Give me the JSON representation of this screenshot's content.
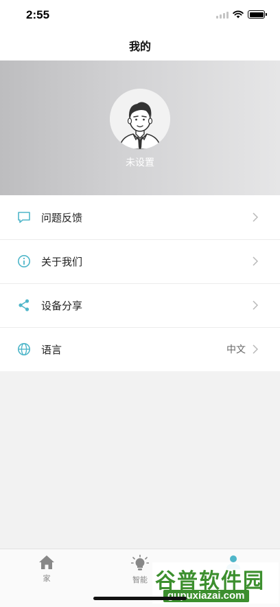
{
  "status_bar": {
    "time": "2:55"
  },
  "header": {
    "title": "我的"
  },
  "profile": {
    "name": "未设置"
  },
  "menu": {
    "items": [
      {
        "label": "问题反馈",
        "icon": "chat-bubble-icon"
      },
      {
        "label": "关于我们",
        "icon": "info-icon"
      },
      {
        "label": "设备分享",
        "icon": "share-icon"
      },
      {
        "label": "语言",
        "icon": "globe-icon",
        "value": "中文"
      }
    ]
  },
  "tab_bar": {
    "tabs": [
      {
        "label": "家",
        "icon": "home-icon"
      },
      {
        "label": "智能",
        "icon": "lightbulb-icon"
      },
      {
        "label": "",
        "icon": "profile-icon"
      }
    ]
  },
  "watermark": {
    "title": "谷普软件园",
    "url": "gupuxiazai.com"
  },
  "colors": {
    "accent": "#4fb6c9",
    "watermark_green": "#3c8f2e"
  }
}
